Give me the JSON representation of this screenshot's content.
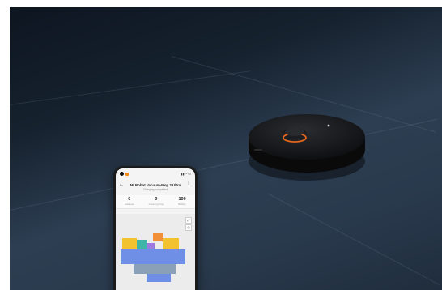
{
  "scene": {
    "description_colors": {
      "floor_dark": "#0d1520",
      "floor_light": "#2d3e52",
      "robot_body": "#121212",
      "robot_accent": "#e8671e"
    }
  },
  "phone": {
    "status": {
      "left": "",
      "right": ""
    },
    "app": {
      "title": "Mi Robot Vacuum-Mop 2 Ultra",
      "subtitle": "Charging completed"
    },
    "stats": [
      {
        "value": "0",
        "unit": "m²",
        "label": "Cleaned"
      },
      {
        "value": "0",
        "unit": "min",
        "label": "Cleaning time"
      },
      {
        "value": "100",
        "unit": "%",
        "label": "Battery"
      }
    ],
    "map_colors": {
      "yellow": "#f2c230",
      "orange": "#f0903a",
      "blue": "#6f8ee6",
      "teal": "#3fb5a8",
      "purple": "#9b7be0",
      "gray": "#8aa0b8"
    }
  }
}
